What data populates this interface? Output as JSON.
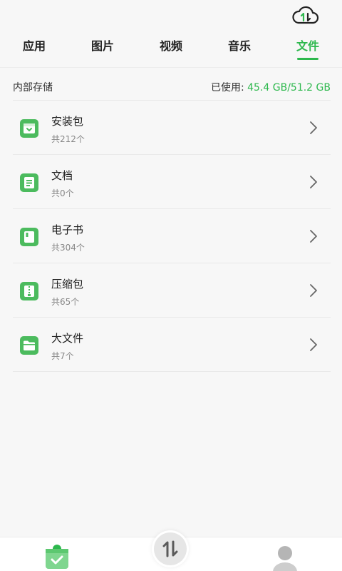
{
  "colors": {
    "accent": "#2db84d",
    "icon_green": "#4cbb5e",
    "gray": "#e6e6e6"
  },
  "topbar": {
    "cloud_icon": "cloud-transfer-icon"
  },
  "tabs": [
    {
      "label": "应用",
      "active": false
    },
    {
      "label": "图片",
      "active": false
    },
    {
      "label": "视频",
      "active": false
    },
    {
      "label": "音乐",
      "active": false
    },
    {
      "label": "文件",
      "active": true
    }
  ],
  "storage": {
    "title": "内部存储",
    "used_label": "已使用:",
    "used_value": "45.4 GB/51.2 GB"
  },
  "items": [
    {
      "name": "安装包",
      "count": "共212个",
      "icon": "package-icon"
    },
    {
      "name": "文档",
      "count": "共0个",
      "icon": "document-icon"
    },
    {
      "name": "电子书",
      "count": "共304个",
      "icon": "ebook-icon"
    },
    {
      "name": "压缩包",
      "count": "共65个",
      "icon": "archive-icon"
    },
    {
      "name": "大文件",
      "count": "共7个",
      "icon": "folder-icon"
    }
  ],
  "bottom_nav": {
    "home_icon": "clipboard-check-icon",
    "transfer_icon": "transfer-arrows-icon",
    "profile_icon": "profile-icon"
  }
}
